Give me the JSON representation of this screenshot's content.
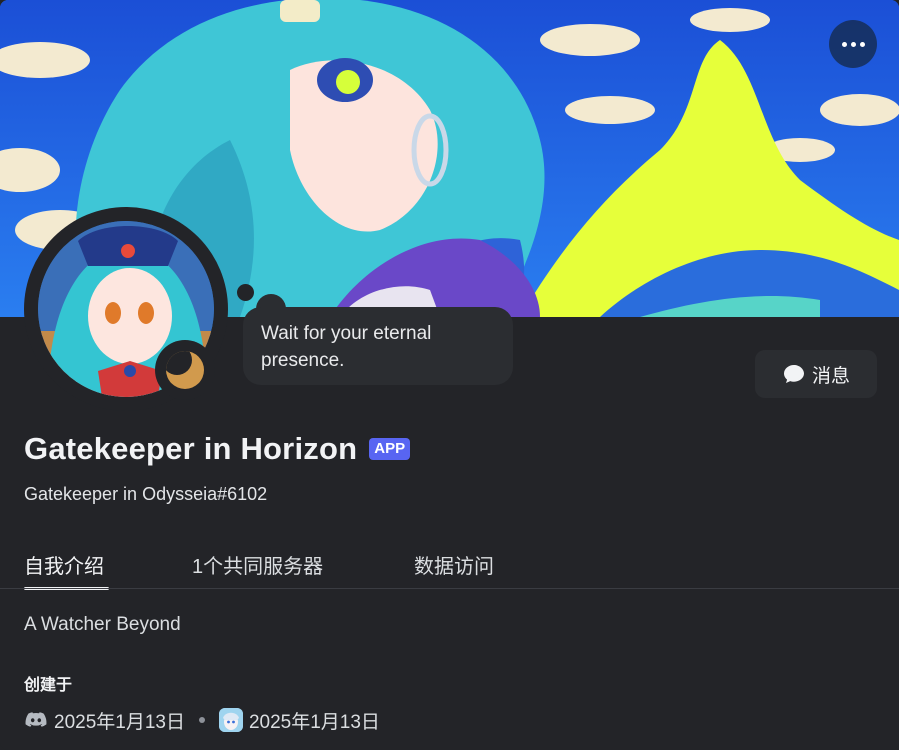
{
  "banner": {
    "image_name": "anime-wave-banner"
  },
  "header": {
    "more_icon": "ellipsis-icon"
  },
  "profile": {
    "custom_status": "Wait for your eternal presence.",
    "display_name": "Gatekeeper in Horizon",
    "badge": "APP",
    "username": "Gatekeeper in Odysseia#6102",
    "status_icon": "idle-moon-icon",
    "status_color": "#d19a4d"
  },
  "actions": {
    "message_label": "消息",
    "message_icon": "chat-bubble-icon"
  },
  "tabs": [
    {
      "label": "自我介绍",
      "active": true
    },
    {
      "label": "1个共同服务器",
      "active": false
    },
    {
      "label": "数据访问",
      "active": false
    }
  ],
  "about": {
    "bio": "A Watcher Beyond",
    "created_title": "创建于",
    "discord_date": "2025年1月13日",
    "server_date": "2025年1月13日",
    "discord_icon": "discord-icon",
    "server_icon": "server-avatar-icon"
  },
  "colors": {
    "accent": "#5865f2",
    "background": "#232428",
    "surface": "#2b2d31"
  }
}
